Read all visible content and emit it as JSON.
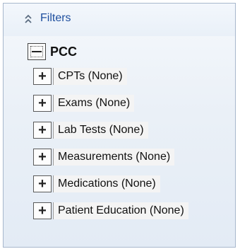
{
  "panel": {
    "header": {
      "label": "Filters",
      "icon": "double-chevron-up-icon"
    },
    "root": {
      "label": "PCC",
      "toggle": "−",
      "expanded": true
    },
    "items": [
      {
        "label": "CPTs (None)",
        "toggle": "+"
      },
      {
        "label": "Exams (None)",
        "toggle": "+"
      },
      {
        "label": "Lab Tests (None)",
        "toggle": "+"
      },
      {
        "label": "Measurements (None)",
        "toggle": "+"
      },
      {
        "label": "Medications (None)",
        "toggle": "+"
      },
      {
        "label": "Patient Education (None)",
        "toggle": "+"
      }
    ]
  },
  "colors": {
    "header_text": "#1d4e9e",
    "border": "#a7b7cc",
    "background": "#eaf0f7"
  }
}
